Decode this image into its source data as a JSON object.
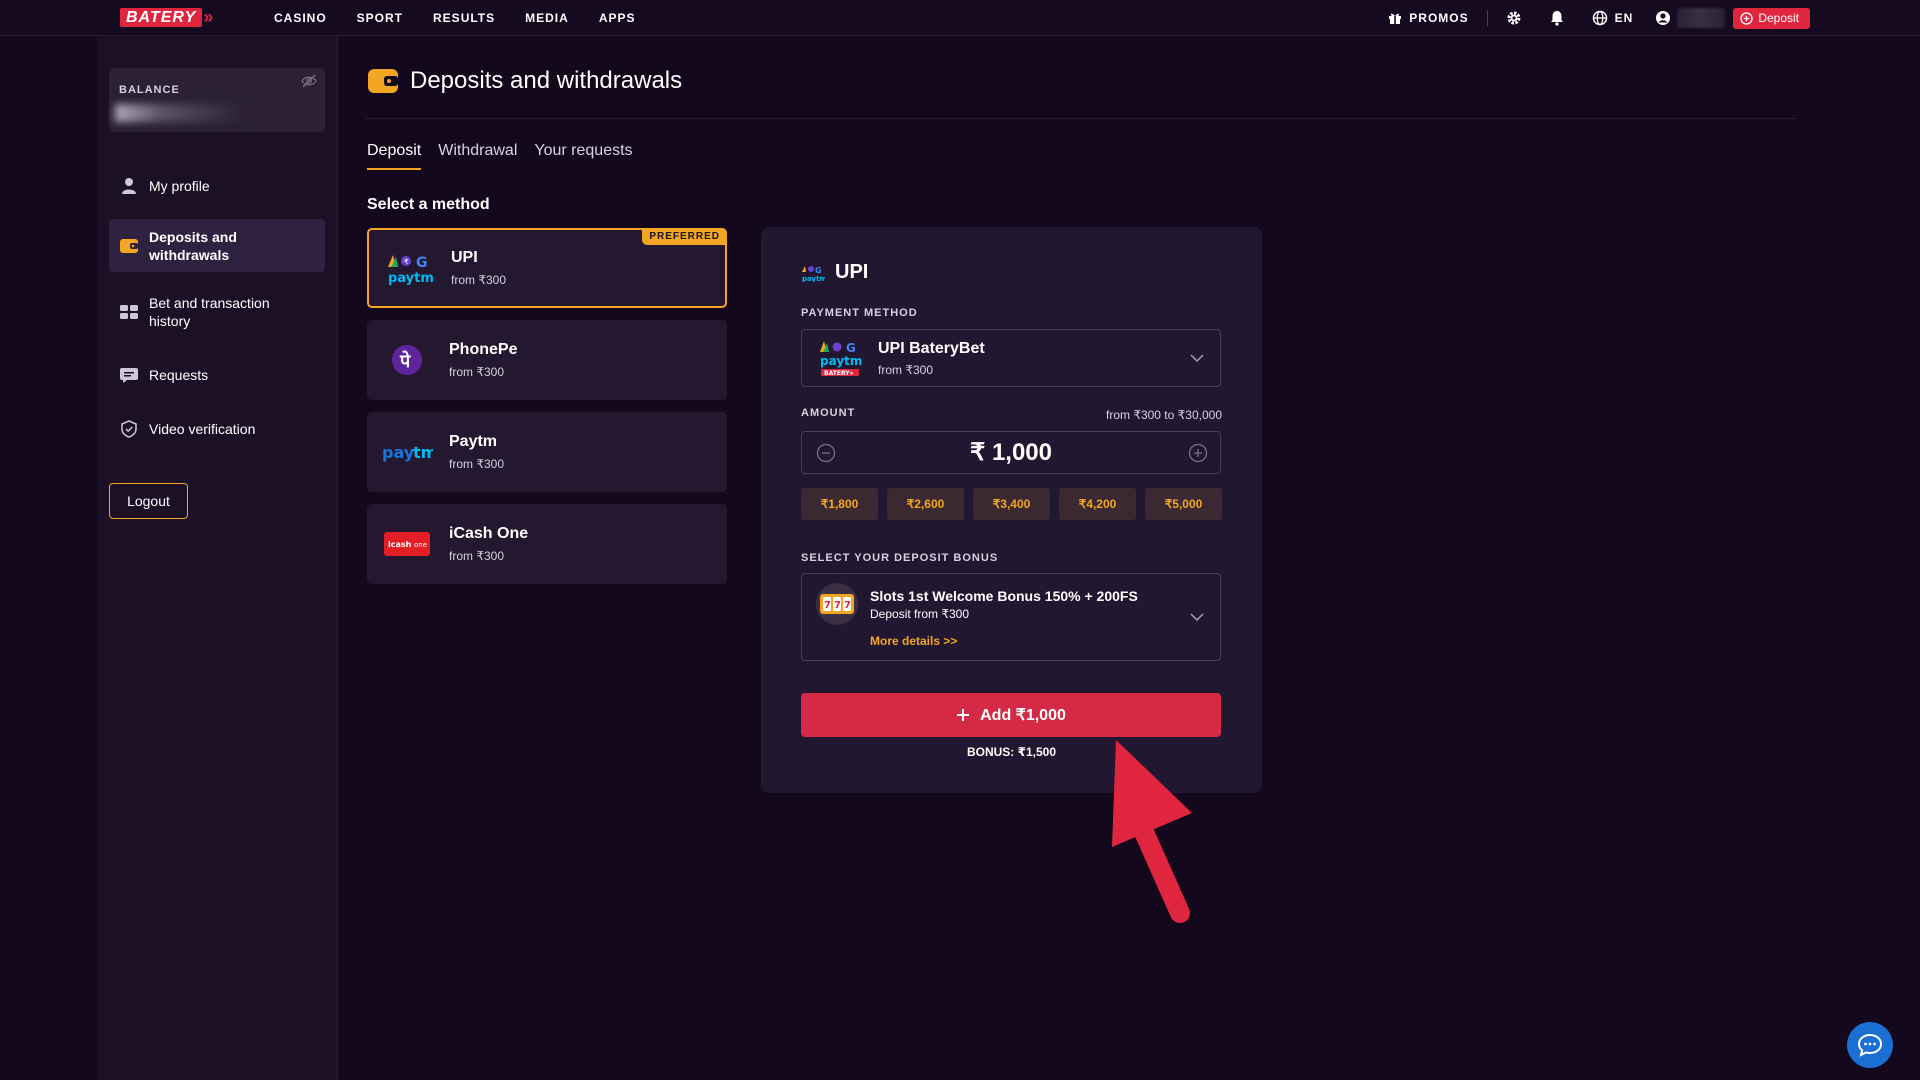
{
  "brand": {
    "logo_text": "BATERY",
    "accent": "#e0263f",
    "gold": "#f2a623"
  },
  "nav": {
    "items": [
      "CASINO",
      "SPORT",
      "RESULTS",
      "MEDIA",
      "APPS"
    ]
  },
  "header": {
    "promos": "PROMOS",
    "lang": "EN",
    "deposit": "Deposit"
  },
  "sidebar": {
    "balance_label": "BALANCE",
    "items": [
      {
        "label": "My profile",
        "icon": "user-icon"
      },
      {
        "label": "Deposits and withdrawals",
        "icon": "wallet-icon"
      },
      {
        "label": "Bet and transaction history",
        "icon": "history-icon"
      },
      {
        "label": "Requests",
        "icon": "chat-icon"
      },
      {
        "label": "Video verification",
        "icon": "shield-check-icon"
      }
    ],
    "logout": "Logout"
  },
  "main": {
    "title": "Deposits and withdrawals",
    "tabs": [
      "Deposit",
      "Withdrawal",
      "Your requests"
    ],
    "select_method": "Select a method",
    "methods": [
      {
        "name": "UPI",
        "sub": "from ₹300",
        "badge": "PREFERRED"
      },
      {
        "name": "PhonePe",
        "sub": "from ₹300"
      },
      {
        "name": "Paytm",
        "sub": "from ₹300"
      },
      {
        "name": "iCash One",
        "sub": "from ₹300"
      }
    ]
  },
  "panel": {
    "title": "UPI",
    "payment_method_label": "PAYMENT METHOD",
    "payment_method": {
      "name": "UPI BateryBet",
      "sub": "from ₹300"
    },
    "amount_label": "AMOUNT",
    "amount_range": "from ₹300 to ₹30,000",
    "amount_value": "₹ 1,000",
    "quick_amounts": [
      "₹1,800",
      "₹2,600",
      "₹3,400",
      "₹4,200",
      "₹5,000"
    ],
    "bonus_label": "SELECT YOUR DEPOSIT BONUS",
    "bonus": {
      "title": "Slots 1st Welcome Bonus 150% + 200FS",
      "sub": "Deposit from ₹300",
      "more": "More details >>"
    },
    "add_button": "Add ₹1,000",
    "bonus_note": "BONUS: ₹1,500"
  }
}
